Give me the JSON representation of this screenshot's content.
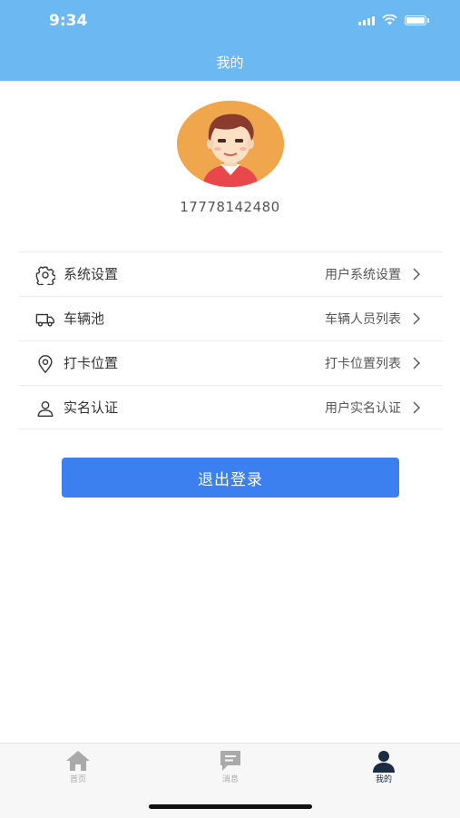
{
  "status": {
    "time": "9:34"
  },
  "header": {
    "title": "我的"
  },
  "profile": {
    "phone": "17778142480"
  },
  "menu": [
    {
      "label": "系统设置",
      "value": "用户系统设置",
      "icon": "gear-icon"
    },
    {
      "label": "车辆池",
      "value": "车辆人员列表",
      "icon": "truck-icon"
    },
    {
      "label": "打卡位置",
      "value": "打卡位置列表",
      "icon": "location-pin-icon"
    },
    {
      "label": "实名认证",
      "value": "用户实名认证",
      "icon": "user-icon"
    }
  ],
  "logout": {
    "label": "退出登录"
  },
  "tabbar": {
    "items": [
      {
        "label": "首页",
        "icon": "home-icon",
        "active": false
      },
      {
        "label": "消息",
        "icon": "message-icon",
        "active": false
      },
      {
        "label": "我的",
        "icon": "person-icon",
        "active": true
      }
    ]
  },
  "colors": {
    "header": "#6cb8f2",
    "button": "#3b7ff0",
    "tab_active": "#1c2a44",
    "tab_inactive": "#aaaaaa"
  }
}
